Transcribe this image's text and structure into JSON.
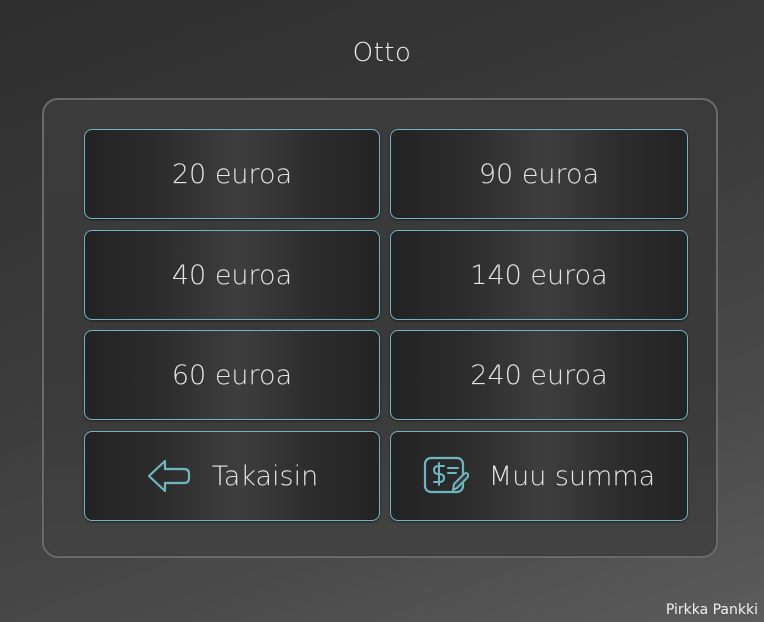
{
  "screen": {
    "title": "Otto"
  },
  "amounts": [
    {
      "label": "20 euroa"
    },
    {
      "label": "90 euroa"
    },
    {
      "label": "40 euroa"
    },
    {
      "label": "140 euroa"
    },
    {
      "label": "60 euroa"
    },
    {
      "label": "240 euroa"
    }
  ],
  "actions": {
    "back": {
      "label": "Takaisin",
      "icon": "arrow-left-icon"
    },
    "other": {
      "label": "Muu summa",
      "icon": "money-edit-icon"
    }
  },
  "footer": {
    "brand": "Pirkka Pankki"
  },
  "colors": {
    "button_border": "#6fb6c4",
    "icon": "#6fb6c4"
  }
}
